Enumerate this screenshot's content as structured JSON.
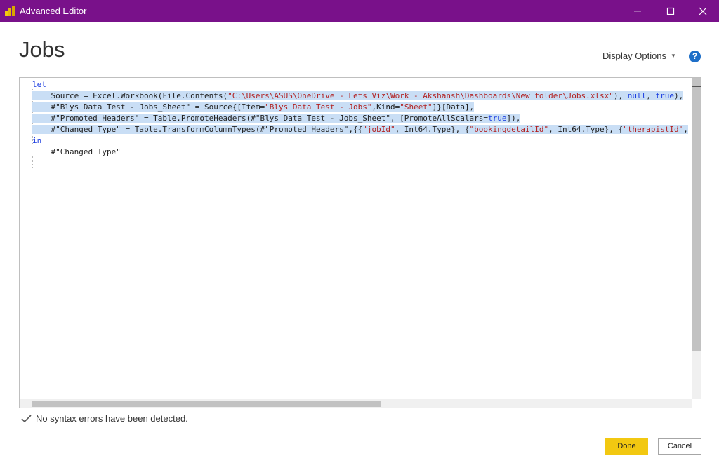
{
  "window": {
    "title": "Advanced Editor",
    "accent_color": "#79118a"
  },
  "header": {
    "query_name": "Jobs",
    "display_options_label": "Display Options",
    "help_icon_text": "?"
  },
  "editor": {
    "lines": [
      {
        "selected": false,
        "tokens": [
          {
            "t": "let",
            "c": "kw"
          }
        ]
      },
      {
        "selected": true,
        "tokens": [
          {
            "t": "    Source = Excel.Workbook(File.Contents(",
            "c": ""
          },
          {
            "t": "\"C:\\Users\\ASUS\\OneDrive - Lets Viz\\Work - Akshansh\\Dashboards\\New folder\\Jobs.xlsx\"",
            "c": "str"
          },
          {
            "t": "), ",
            "c": ""
          },
          {
            "t": "null",
            "c": "kw"
          },
          {
            "t": ", ",
            "c": ""
          },
          {
            "t": "true",
            "c": "kw"
          },
          {
            "t": "),",
            "c": ""
          }
        ]
      },
      {
        "selected": true,
        "tokens": [
          {
            "t": "    #\"Blys Data Test - Jobs_Sheet\" = Source{[Item=",
            "c": ""
          },
          {
            "t": "\"Blys Data Test - Jobs\"",
            "c": "str"
          },
          {
            "t": ",Kind=",
            "c": ""
          },
          {
            "t": "\"Sheet\"",
            "c": "str"
          },
          {
            "t": "]}[Data],",
            "c": ""
          }
        ]
      },
      {
        "selected": true,
        "tokens": [
          {
            "t": "    #\"Promoted Headers\" = Table.PromoteHeaders(#\"Blys Data Test - Jobs_Sheet\", [PromoteAllScalars=",
            "c": ""
          },
          {
            "t": "true",
            "c": "kw"
          },
          {
            "t": "]),",
            "c": ""
          }
        ]
      },
      {
        "selected": true,
        "tokens": [
          {
            "t": "    #\"Changed Type\" = Table.TransformColumnTypes(#\"Promoted Headers\",{{",
            "c": ""
          },
          {
            "t": "\"jobId\"",
            "c": "str"
          },
          {
            "t": ", Int64.Type}, {",
            "c": ""
          },
          {
            "t": "\"bookingdetailId\"",
            "c": "str"
          },
          {
            "t": ", Int64.Type}, {",
            "c": ""
          },
          {
            "t": "\"therapistId\"",
            "c": "str"
          },
          {
            "t": ",",
            "c": ""
          }
        ]
      },
      {
        "selected": false,
        "tokens": [
          {
            "t": "in",
            "c": "kw"
          }
        ]
      },
      {
        "selected": false,
        "tokens": [
          {
            "t": "    #\"Changed Type\"",
            "c": ""
          }
        ]
      }
    ]
  },
  "status": {
    "message": "No syntax errors have been detected."
  },
  "buttons": {
    "done_label": "Done",
    "cancel_label": "Cancel"
  },
  "colors": {
    "selection": "#c9def5",
    "keyword": "#1a3ce0",
    "string": "#b22222",
    "done_button": "#f2c811"
  }
}
